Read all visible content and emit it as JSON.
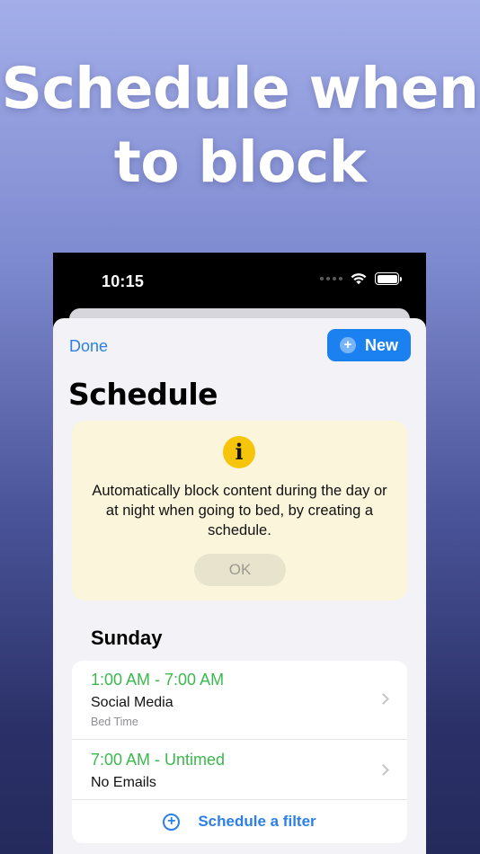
{
  "headline": {
    "line1": "Schedule when",
    "line2": "to block"
  },
  "status_bar": {
    "time": "10:15",
    "icons": [
      "signal-icon",
      "wifi-icon",
      "battery-icon"
    ]
  },
  "toolbar": {
    "done_label": "Done",
    "new_label": "New"
  },
  "page_title": "Schedule",
  "info_card": {
    "icon": "info-icon",
    "message": "Automatically block content during the day or at night when going to bed, by creating a schedule.",
    "ok_label": "OK"
  },
  "schedule": {
    "day": "Sunday",
    "items": [
      {
        "time": "1:00 AM - 7:00 AM",
        "name": "Social Media",
        "subtitle": "Bed Time"
      },
      {
        "time": "7:00 AM - Untimed",
        "name": "No Emails",
        "subtitle": ""
      }
    ],
    "add_label": "Schedule a filter"
  },
  "colors": {
    "accent_blue": "#1b80f0",
    "link_blue": "#2c7fe6",
    "time_green": "#3cb94e",
    "info_yellow": "#f5c40b",
    "info_card_bg": "#fbf5db"
  }
}
